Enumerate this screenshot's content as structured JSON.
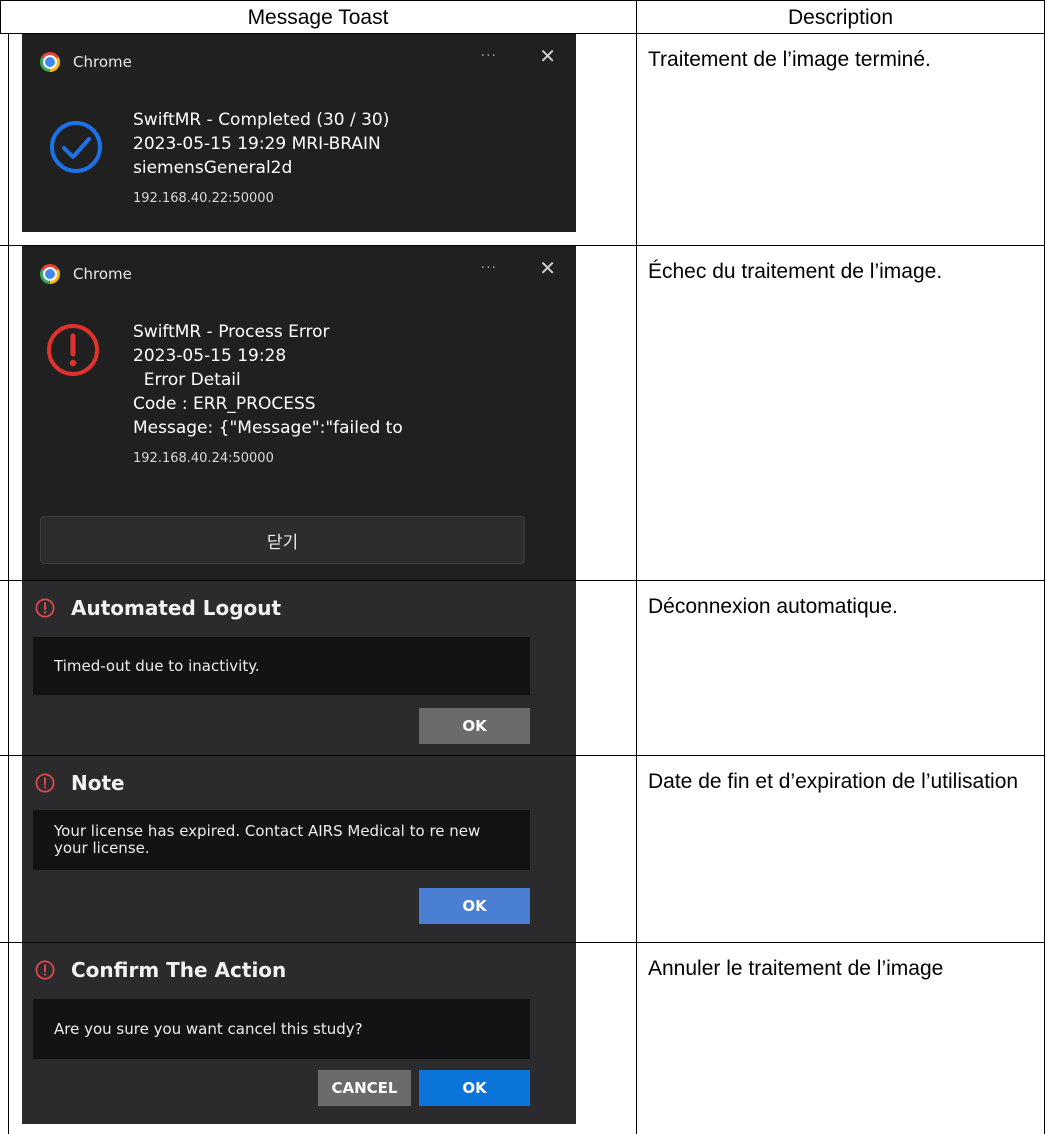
{
  "table": {
    "headers": {
      "toast": "Message Toast",
      "description": "Description"
    }
  },
  "rows": [
    {
      "description": "Traitement de l’image terminé.",
      "toast": {
        "app": "Chrome",
        "more_icon": "more-horizontal-icon",
        "close_icon": "close-icon",
        "status_icon": "check-circle-icon",
        "status_color": "#1a73e8",
        "lines": [
          "SwiftMR - Completed (30 / 30)",
          "2023-05-15 19:29 MRI-BRAIN",
          "siemensGeneral2d"
        ],
        "origin": "192.168.40.22:50000"
      }
    },
    {
      "description": "Échec du traitement de l’image.",
      "toast": {
        "app": "Chrome",
        "more_icon": "more-horizontal-icon",
        "close_icon": "close-icon",
        "status_icon": "error-circle-icon",
        "status_color": "#e0322c",
        "lines": [
          "SwiftMR - Process Error",
          "2023-05-15 19:28",
          "  Error Detail",
          "Code : ERR_PROCESS",
          "Message: {\"Message\":\"failed to"
        ],
        "origin": "192.168.40.24:50000",
        "button": "닫기"
      }
    },
    {
      "description": "Déconnexion automatique.",
      "dialog": {
        "title": "Automated Logout",
        "message": "Timed-out due to inactivity.",
        "buttons": [
          "OK"
        ]
      }
    },
    {
      "description": "Date de fin et d’expiration de l’utilisation",
      "dialog": {
        "title": "Note",
        "message": "Your license has expired. Contact AIRS Medical to re new your license.",
        "buttons": [
          "OK"
        ]
      }
    },
    {
      "description": "Annuler le traitement de l’image",
      "dialog": {
        "title": "Confirm The Action",
        "message": "Are you sure you want cancel this study?",
        "buttons": [
          "CANCEL",
          "OK"
        ]
      }
    }
  ],
  "colors": {
    "toast_bg": "#202020",
    "dialog_bg": "#2b2b2d",
    "dialog_body_bg": "#131315",
    "alert_red": "#e04848",
    "button_gray": "#6b6b6b",
    "button_blue": "#0a74da"
  }
}
